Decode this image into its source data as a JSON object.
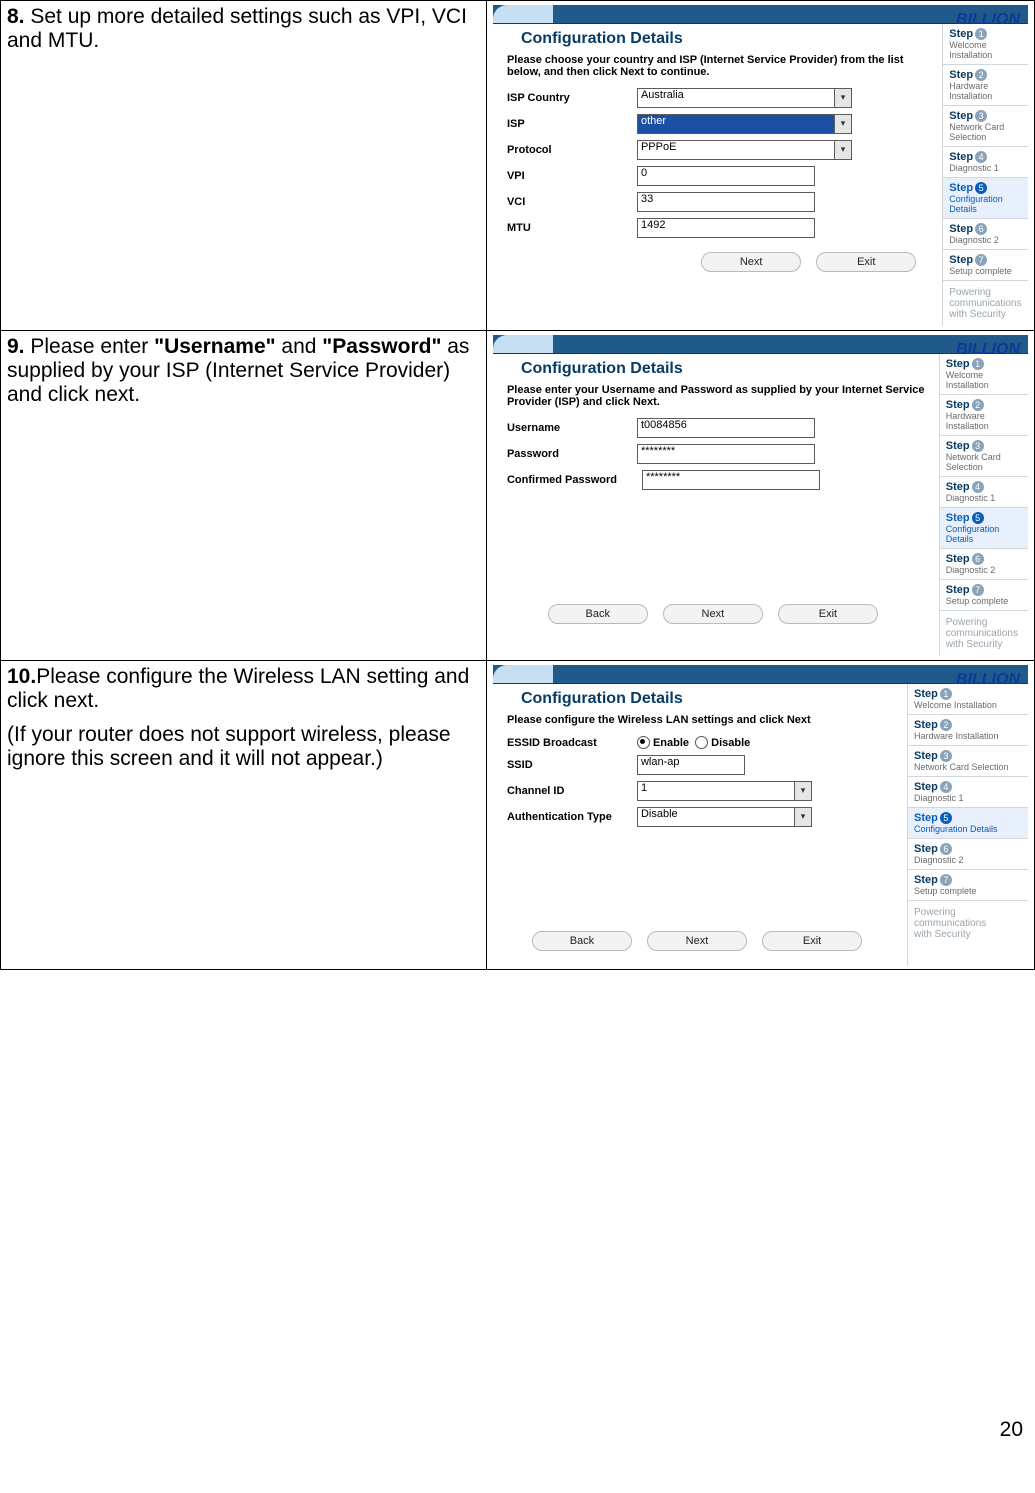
{
  "page_number": "20",
  "steps_sidebar": [
    {
      "title": "Step",
      "num": "1",
      "sub": "Welcome Installation"
    },
    {
      "title": "Step",
      "num": "2",
      "sub": "Hardware Installation"
    },
    {
      "title": "Step",
      "num": "3",
      "sub": "Network Card Selection"
    },
    {
      "title": "Step",
      "num": "4",
      "sub": "Diagnostic 1"
    },
    {
      "title": "Step",
      "num": "5",
      "sub": "Configuration Details"
    },
    {
      "title": "Step",
      "num": "6",
      "sub": "Diagnostic 2"
    },
    {
      "title": "Step",
      "num": "7",
      "sub": "Setup complete"
    }
  ],
  "brand": "BILLION",
  "footer_tag_a": "Powering communications",
  "footer_tag_b": "with Security",
  "buttons": {
    "next": "Next",
    "exit": "Exit",
    "back": "Back"
  },
  "row8": {
    "num": "8.",
    "text": "Set up more detailed settings such as VPI, VCI and MTU.",
    "heading": "Configuration Details",
    "instr": "Please choose your country and ISP (Internet Service Provider) from the list below, and then click Next to continue.",
    "labels": {
      "country": "ISP Country",
      "isp": "ISP",
      "proto": "Protocol",
      "vpi": "VPI",
      "vci": "VCI",
      "mtu": "MTU"
    },
    "values": {
      "country": "Australia",
      "isp": "other",
      "proto": "PPPoE",
      "vpi": "0",
      "vci": "33",
      "mtu": "1492"
    }
  },
  "row9": {
    "num": "9.",
    "text_a": "Please enter ",
    "text_b": "\"Username\"",
    "text_c": " and ",
    "text_d": "\"Password\"",
    "text_e": " as supplied by your ISP (Internet Service Provider) and click next.",
    "heading": "Configuration Details",
    "instr": "Please enter your Username and Password as supplied by your Internet Service Provider (ISP) and click Next.",
    "labels": {
      "user": "Username",
      "pass": "Password",
      "conf": "Confirmed Password"
    },
    "values": {
      "user": "t0084856",
      "pass": "********",
      "conf": "********"
    }
  },
  "row10": {
    "num": "10.",
    "text": "Please configure the Wireless LAN setting and click next.",
    "note": "(If your router does not support wireless, please ignore this screen and it will not appear.)",
    "heading": "Configuration Details",
    "instr": "Please configure the Wireless LAN settings and click Next",
    "labels": {
      "essid": "ESSID Broadcast",
      "ssid": "SSID",
      "chan": "Channel ID",
      "auth": "Authentication Type",
      "en": "Enable",
      "dis": "Disable"
    },
    "values": {
      "ssid": "wlan-ap",
      "chan": "1",
      "auth": "Disable"
    }
  }
}
